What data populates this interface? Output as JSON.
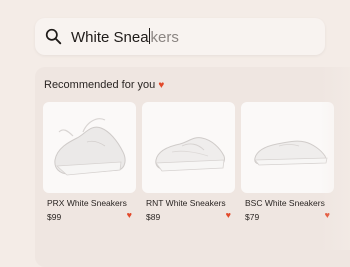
{
  "search": {
    "typed": "White Snea",
    "remaining": "kers",
    "icon": "search-icon"
  },
  "recommended": {
    "title": "Recommended for you",
    "heart_icon": "heart-icon",
    "accent": "#e2492a"
  },
  "products": [
    {
      "name": "PRX White Sneakers",
      "price": "$99",
      "icon": "heart-icon"
    },
    {
      "name": "RNT White Sneakers",
      "price": "$89",
      "icon": "heart-icon"
    },
    {
      "name": "BSC White Sneakers",
      "price": "$79",
      "icon": "heart-icon"
    }
  ]
}
